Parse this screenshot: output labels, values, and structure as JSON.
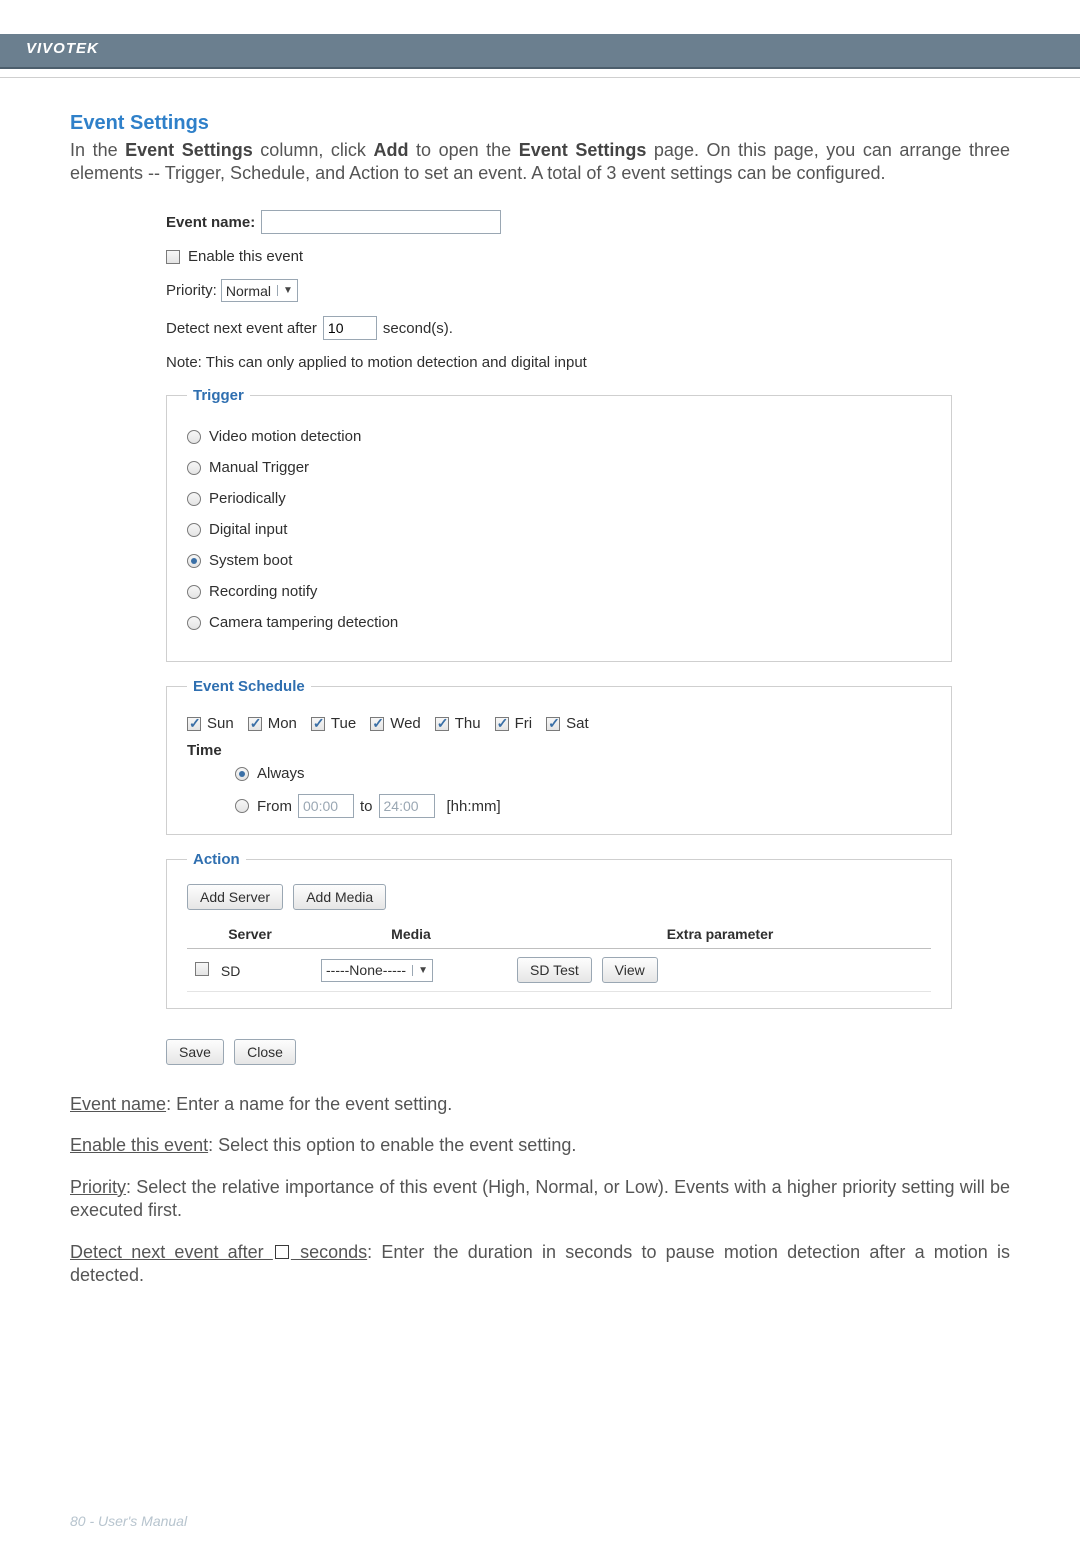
{
  "header": {
    "brand": "VIVOTEK"
  },
  "section_title": "Event Settings",
  "intro": {
    "pre": "In the ",
    "b1": "Event Settings",
    "mid1": " column, click ",
    "b2": "Add",
    "mid2": " to open the ",
    "b3": "Event Settings",
    "post": " page. On this page, you can arrange three elements -- Trigger, Schedule, and Action to set an event. A total of 3 event settings can be configured."
  },
  "form": {
    "event_name_label": "Event name:",
    "event_name_value": "",
    "enable_label": "Enable this event",
    "priority_label": "Priority:",
    "priority_value": "Normal",
    "detect_pre": "Detect next event after",
    "detect_value": "10",
    "detect_post": "second(s).",
    "note": "Note: This can only applied to motion detection and digital input"
  },
  "trigger": {
    "legend": "Trigger",
    "options": [
      "Video motion detection",
      "Manual Trigger",
      "Periodically",
      "Digital input",
      "System boot",
      "Recording notify",
      "Camera tampering detection"
    ],
    "selected_index": 4
  },
  "schedule": {
    "legend": "Event Schedule",
    "days": [
      "Sun",
      "Mon",
      "Tue",
      "Wed",
      "Thu",
      "Fri",
      "Sat"
    ],
    "time_label": "Time",
    "always_label": "Always",
    "from_label": "From",
    "from_value": "00:00",
    "to_label": "to",
    "to_value": "24:00",
    "format_hint": "[hh:mm]",
    "time_mode": "always"
  },
  "action": {
    "legend": "Action",
    "add_server_btn": "Add Server",
    "add_media_btn": "Add Media",
    "headers": {
      "server": "Server",
      "media": "Media",
      "extra": "Extra parameter"
    },
    "row": {
      "server_label": "SD",
      "media_value": "-----None-----",
      "sd_test_btn": "SD Test",
      "view_btn": "View"
    }
  },
  "buttons": {
    "save": "Save",
    "close": "Close"
  },
  "glossary": {
    "event_name": {
      "term": "Event name",
      "desc": ": Enter a name for the event setting."
    },
    "enable": {
      "term": "Enable this event",
      "desc": ": Select this option to enable the event setting."
    },
    "priority": {
      "term": "Priority",
      "desc": ": Select the relative importance of this event (High, Normal, or Low). Events with a higher priority setting will be executed first."
    },
    "detect": {
      "term_pre": "Detect next event after ",
      "term_post": " seconds",
      "desc": ": Enter the duration in seconds to pause motion detection after a motion is detected."
    }
  },
  "footer": {
    "page": "80",
    "sep": " - ",
    "title": "User's Manual"
  }
}
